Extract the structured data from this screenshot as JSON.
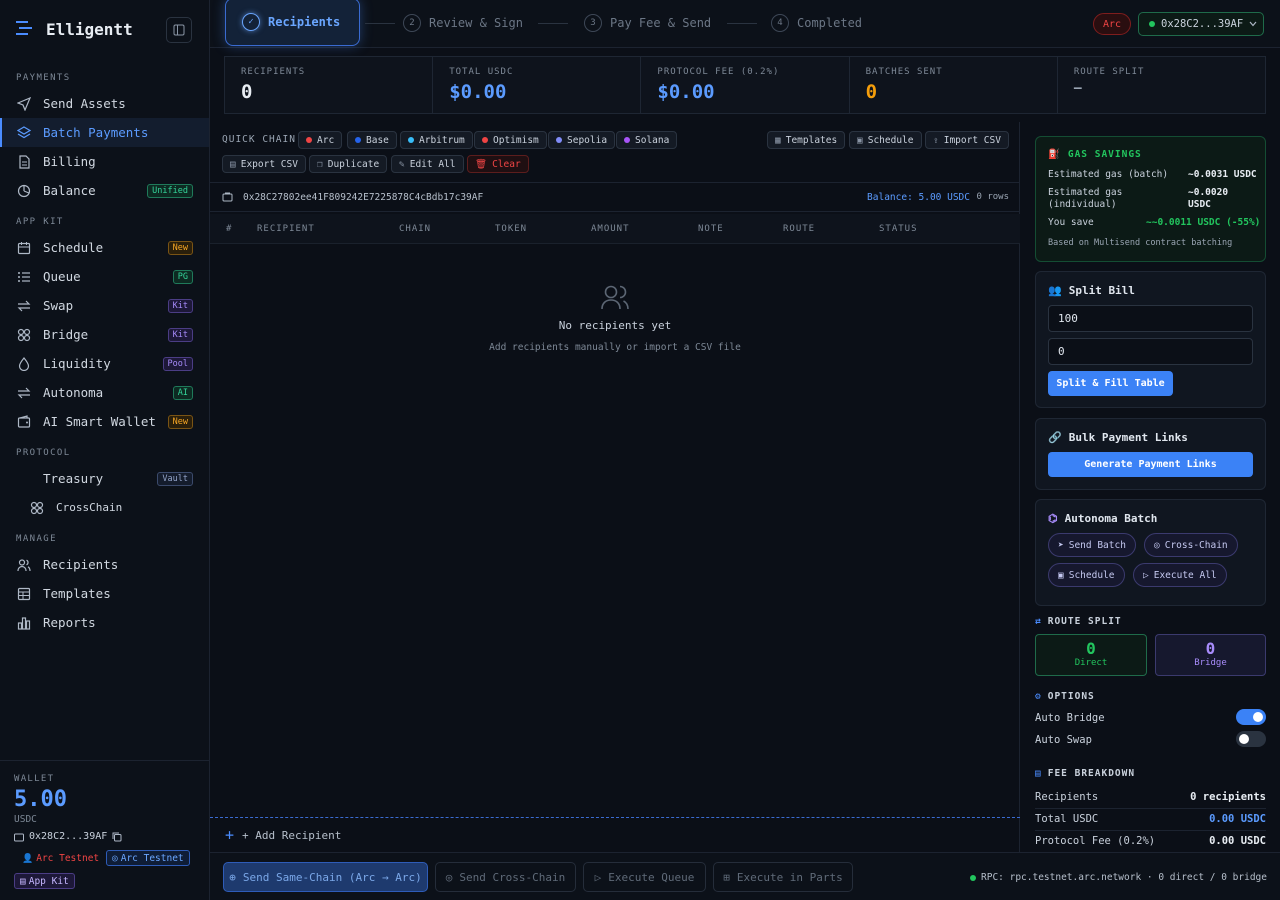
{
  "brand": {
    "name": "Elligentt"
  },
  "sidebar": {
    "payments_title": "PAYMENTS",
    "payments": [
      {
        "label": "Send Assets"
      },
      {
        "label": "Batch Payments"
      },
      {
        "label": "Billing"
      },
      {
        "label": "Balance",
        "badge": "Unified"
      }
    ],
    "appkit_title": "APP KIT",
    "appkit": [
      {
        "label": "Schedule",
        "badge": "New"
      },
      {
        "label": "Queue",
        "badge": "PG"
      },
      {
        "label": "Swap",
        "badge": "Kit"
      },
      {
        "label": "Bridge",
        "badge": "Kit"
      },
      {
        "label": "Liquidity",
        "badge": "Pool"
      },
      {
        "label": "Autonoma",
        "badge": "AI"
      },
      {
        "label": "AI Smart Wallet",
        "badge": "New"
      }
    ],
    "protocol_title": "PROTOCOL",
    "protocol": [
      {
        "label": "Treasury",
        "badge": "Vault"
      },
      {
        "label": "CrossChain"
      }
    ],
    "manage_title": "MANAGE",
    "manage": [
      {
        "label": "Recipients"
      },
      {
        "label": "Templates"
      },
      {
        "label": "Reports"
      }
    ]
  },
  "wallet": {
    "title": "WALLET",
    "balance": "5.00",
    "unit": "USDC",
    "address": "0x28C2...39AF",
    "network_badge": "Arc Testnet",
    "network_chip": "Arc Testnet",
    "appkit": "App Kit"
  },
  "steps": [
    {
      "num": "✓",
      "label": "Recipients"
    },
    {
      "num": "2",
      "label": "Review & Sign"
    },
    {
      "num": "3",
      "label": "Pay Fee & Send"
    },
    {
      "num": "4",
      "label": "Completed"
    }
  ],
  "topbar": {
    "network": "Arc",
    "address": "0x28C2...39AF"
  },
  "stats": [
    {
      "label": "RECIPIENTS",
      "value": "0"
    },
    {
      "label": "TOTAL USDC",
      "value": "$0.00"
    },
    {
      "label": "PROTOCOL FEE (0.2%)",
      "value": "$0.00"
    },
    {
      "label": "BATCHES SENT",
      "value": "0"
    },
    {
      "label": "ROUTE SPLIT",
      "value": "—"
    }
  ],
  "quick_chain": {
    "label": "QUICK CHAIN:",
    "chains": [
      {
        "label": "Arc",
        "color": "#ef4444"
      },
      {
        "label": "Base",
        "color": "#2563eb"
      },
      {
        "label": "Arbitrum",
        "color": "#38bdf8"
      },
      {
        "label": "Optimism",
        "color": "#ef4444"
      },
      {
        "label": "Sepolia",
        "color": "#818cf8"
      },
      {
        "label": "Solana",
        "color": "#a855f7"
      }
    ]
  },
  "toolbar": {
    "templates": "Templates",
    "schedule": "Schedule",
    "import_csv": "Import CSV",
    "export_csv": "Export CSV",
    "duplicate": "Duplicate",
    "edit_all": "Edit All",
    "clear": "Clear"
  },
  "address_bar": {
    "address": "0x28C27802ee41F809242E7225878C4cBdb17c39AF",
    "balance": "Balance: 5.00 USDC",
    "rows": "0 rows"
  },
  "table": {
    "columns": [
      "#",
      "RECIPIENT",
      "CHAIN",
      "TOKEN",
      "AMOUNT",
      "NOTE",
      "ROUTE",
      "STATUS"
    ],
    "empty_title": "No recipients yet",
    "empty_sub": "Add recipients manually or import a CSV file",
    "add_label": "+ Add Recipient"
  },
  "gas": {
    "title": "GAS SAVINGS",
    "batch_label": "Estimated gas (batch)",
    "batch_value": "~0.0031 USDC",
    "individual_label_1": "Estimated gas",
    "individual_label_2": "(individual)",
    "individual_value_1": "~0.0020",
    "individual_value_2": "USDC",
    "save_label": "You save",
    "save_value": "~~0.0011 USDC (-55%)",
    "note": "Based on Multisend contract batching"
  },
  "split_bill": {
    "title": "Split Bill",
    "amount": "100",
    "count": "0",
    "button": "Split & Fill Table"
  },
  "bulk_links": {
    "title": "Bulk Payment Links",
    "button": "Generate Payment Links"
  },
  "autonoma": {
    "title": "Autonoma Batch",
    "send_batch": "Send Batch",
    "cross_chain": "Cross-Chain",
    "schedule": "Schedule",
    "execute_all": "Execute All"
  },
  "route_split": {
    "title": "ROUTE SPLIT",
    "direct_value": "0",
    "direct_label": "Direct",
    "bridge_value": "0",
    "bridge_label": "Bridge"
  },
  "options": {
    "title": "OPTIONS",
    "auto_bridge": "Auto Bridge",
    "auto_bridge_on": true,
    "auto_swap": "Auto Swap",
    "auto_swap_on": false
  },
  "fee_breakdown": {
    "title": "FEE BREAKDOWN",
    "rows": [
      {
        "label": "Recipients",
        "value": "0 recipients"
      },
      {
        "label": "Total USDC",
        "value": "0.00 USDC"
      },
      {
        "label": "Protocol Fee (0.2%)",
        "value": "0.00 USDC"
      }
    ]
  },
  "bottom": {
    "send_same": "Send Same-Chain (Arc → Arc)",
    "send_cross": "Send Cross-Chain",
    "execute_queue": "Execute Queue",
    "execute_parts": "Execute in Parts",
    "rpc": "RPC: rpc.testnet.arc.network · 0 direct / 0 bridge"
  },
  "colors": {
    "accent": "#4a8cff",
    "success": "#22c55e",
    "warning": "#f59e0b",
    "danger": "#ef4444"
  }
}
